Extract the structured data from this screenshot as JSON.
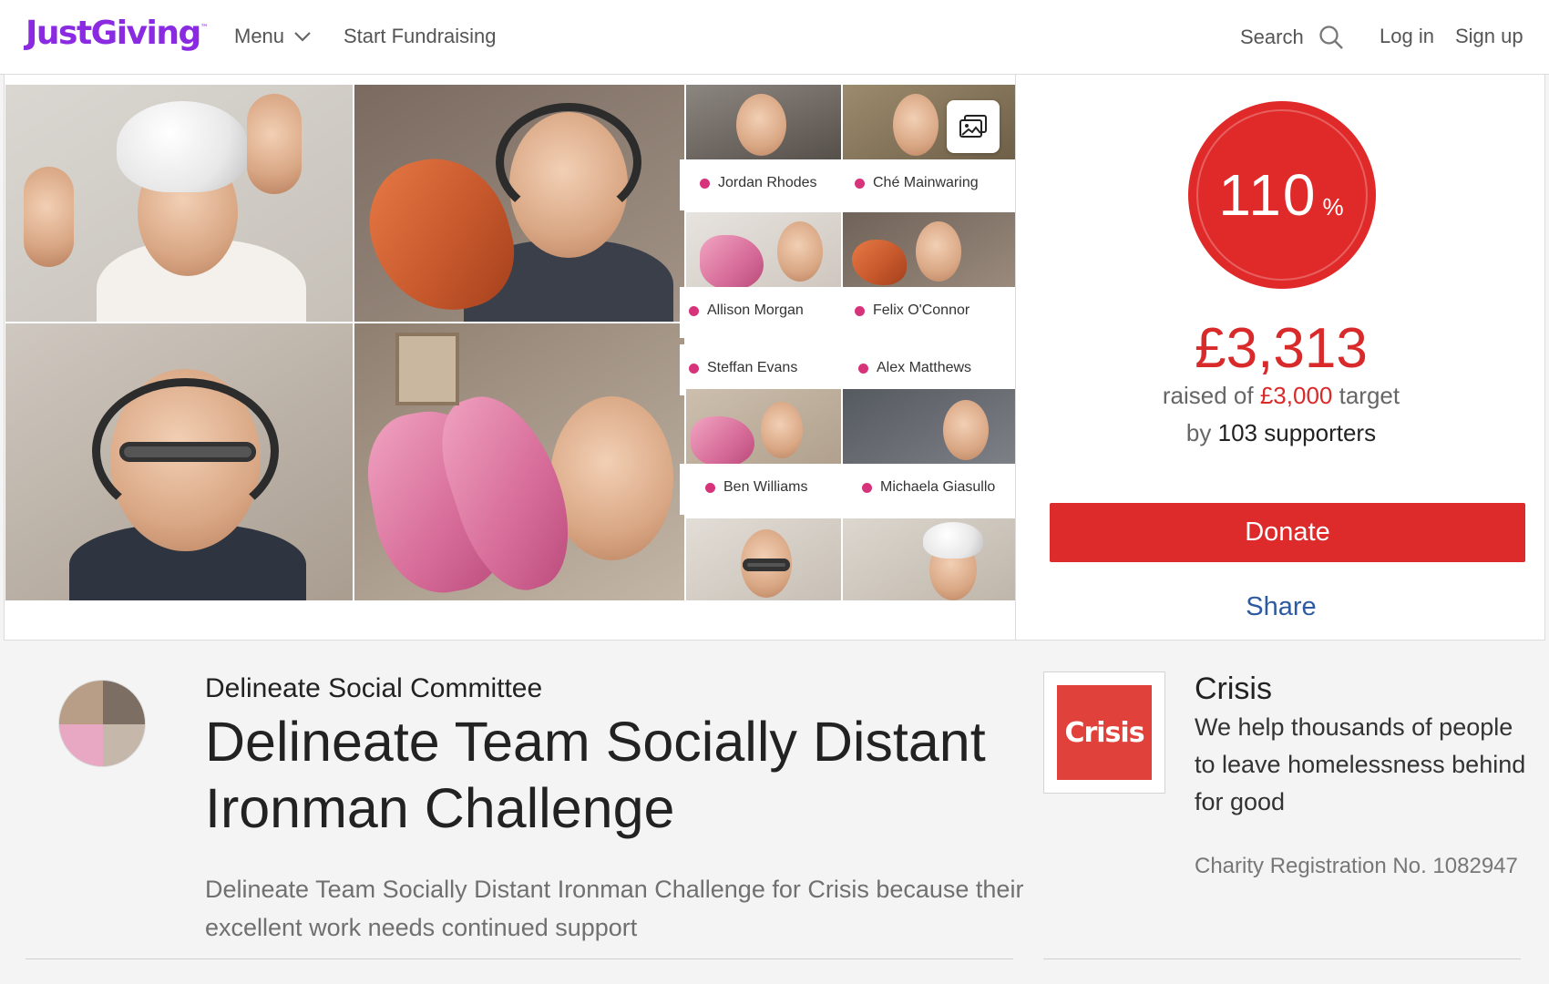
{
  "header": {
    "logo": "JustGiving",
    "logo_tm": "™",
    "menu_label": "Menu",
    "start_label": "Start Fundraising",
    "search_label": "Search",
    "login_label": "Log in",
    "signup_label": "Sign up"
  },
  "hero": {
    "participants": [
      "Jordan Rhodes",
      "Ché Mainwaring",
      "Allison Morgan",
      "Felix O'Connor",
      "Steffan Evans",
      "Alex Matthews",
      "Ben Williams",
      "Michaela Giasullo"
    ],
    "gallery_icon": "image-gallery-icon"
  },
  "progress": {
    "percent": "110",
    "percent_sign": "%",
    "raised_amount": "£3,313",
    "raised_prefix": "raised of",
    "target_amount": "£3,000",
    "target_suffix": "target",
    "by_prefix": "by",
    "supporters": "103 supporters",
    "donate_label": "Donate",
    "share_label": "Share"
  },
  "page": {
    "organiser": "Delineate Social Committee",
    "title": "Delineate Team Socially Distant Ironman Challenge",
    "summary": "Delineate Team Socially Distant Ironman Challenge for Crisis because their excellent work needs continued support"
  },
  "charity": {
    "logo_text": "Crisis",
    "name": "Crisis",
    "description": "We help thousands of people to leave homelessness behind for good",
    "registration": "Charity Registration No. 1082947"
  },
  "colors": {
    "brand": "#8a2be2",
    "accent_red": "#dd2a2a",
    "link_blue": "#2d5aa0",
    "participant_dot": "#d6337a"
  }
}
